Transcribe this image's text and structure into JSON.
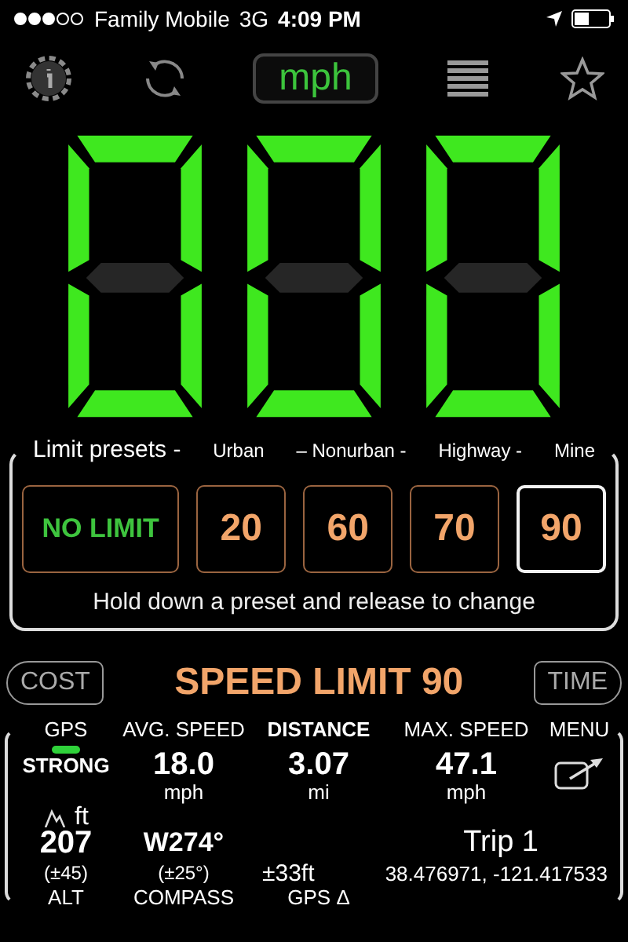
{
  "status_bar": {
    "carrier": "Family Mobile",
    "network": "3G",
    "time": "4:09 PM"
  },
  "toolbar": {
    "unit_button": "mph"
  },
  "speed_display": {
    "digits": [
      {
        "segments": [
          {
            "lit": true
          },
          {
            "lit": true
          },
          {
            "lit": true
          },
          {
            "lit": true
          },
          {
            "lit": true
          },
          {
            "lit": true
          },
          {
            "lit": false
          }
        ]
      },
      {
        "segments": [
          {
            "lit": true
          },
          {
            "lit": true
          },
          {
            "lit": true
          },
          {
            "lit": true
          },
          {
            "lit": true
          },
          {
            "lit": true
          },
          {
            "lit": false
          }
        ]
      },
      {
        "segments": [
          {
            "lit": true
          },
          {
            "lit": true
          },
          {
            "lit": true
          },
          {
            "lit": true
          },
          {
            "lit": true
          },
          {
            "lit": true
          },
          {
            "lit": false
          }
        ]
      }
    ]
  },
  "presets": {
    "header": [
      "Limit presets -",
      "Urban",
      "– Nonurban -",
      "Highway -",
      "Mine"
    ],
    "buttons": [
      {
        "label": "NO LIMIT",
        "kind": "none",
        "selected": false
      },
      {
        "label": "20",
        "kind": "speed",
        "selected": false
      },
      {
        "label": "60",
        "kind": "speed",
        "selected": false
      },
      {
        "label": "70",
        "kind": "speed",
        "selected": false
      },
      {
        "label": "90",
        "kind": "speed",
        "selected": true
      }
    ],
    "hint": "Hold down a preset and release to change"
  },
  "limit_bar": {
    "left_button": "COST",
    "title": "SPEED LIMIT 90",
    "right_button": "TIME"
  },
  "stats": {
    "headers": [
      "GPS",
      "AVG. SPEED",
      "DISTANCE",
      "MAX. SPEED",
      "MENU"
    ],
    "gps_indicator": {
      "color": "#2fd13a"
    },
    "gps_signal": "STRONG",
    "avg_speed": {
      "value": "18.0",
      "unit": "mph"
    },
    "distance": {
      "value": "3.07",
      "unit": "mi"
    },
    "max_speed": {
      "value": "47.1",
      "unit": "mph"
    },
    "altitude": {
      "unit": "ft",
      "value": "207",
      "accuracy": "(±45)"
    },
    "compass": {
      "value": "W274°",
      "accuracy": "(±25°)"
    },
    "gps_accuracy": "±33ft",
    "trip": {
      "name": "Trip 1",
      "coordinates": "38.476971, -121.417533"
    },
    "footer": [
      "ALT",
      "COMPASS",
      "GPS Δ"
    ]
  }
}
